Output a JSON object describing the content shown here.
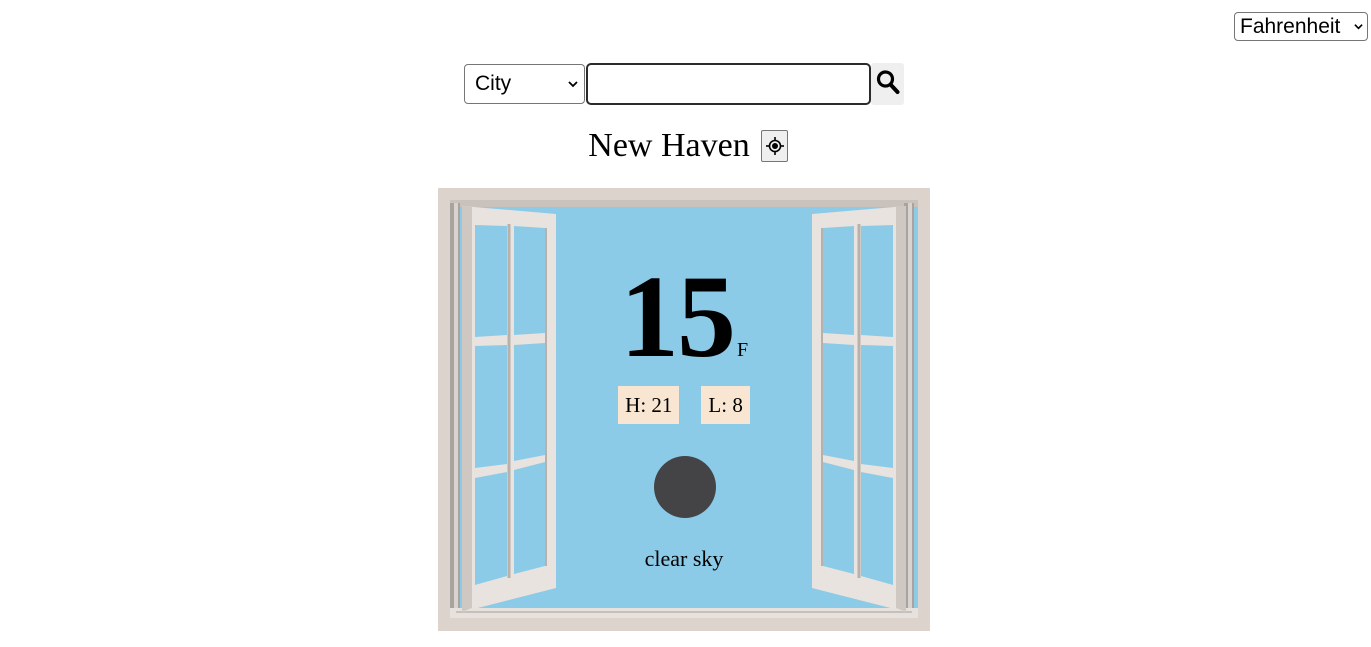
{
  "units": {
    "selected": "Fahrenheit"
  },
  "search": {
    "type_selected": "City",
    "query_value": "",
    "button_icon": "search-icon"
  },
  "location": {
    "city": "New Haven",
    "locate_icon": "crosshair-icon"
  },
  "weather": {
    "temperature": "15",
    "unit": "F",
    "high": "H: 21",
    "low": "L: 8",
    "icon": "weather-condition-icon",
    "description": "clear sky"
  },
  "colors": {
    "sky": "#8bcbe8",
    "frame": "#dcd3cc",
    "badge": "#f8e6d2",
    "icon": "#444446"
  }
}
